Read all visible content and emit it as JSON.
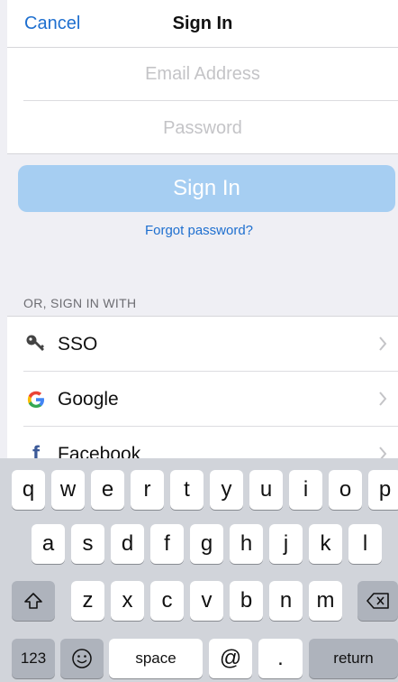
{
  "nav": {
    "cancel_label": "Cancel",
    "title": "Sign In"
  },
  "form": {
    "email_placeholder": "Email Address",
    "password_placeholder": "Password",
    "signin_label": "Sign In",
    "forgot_label": "Forgot password?"
  },
  "providers": {
    "section_label": "OR, SIGN IN WITH",
    "items": [
      {
        "label": "SSO",
        "icon": "key-icon"
      },
      {
        "label": "Google",
        "icon": "google-icon"
      },
      {
        "label": "Facebook",
        "icon": "facebook-icon"
      }
    ]
  },
  "keyboard": {
    "row1": [
      "q",
      "w",
      "e",
      "r",
      "t",
      "y",
      "u",
      "i",
      "o",
      "p"
    ],
    "row2": [
      "a",
      "s",
      "d",
      "f",
      "g",
      "h",
      "j",
      "k",
      "l"
    ],
    "row3": [
      "z",
      "x",
      "c",
      "v",
      "b",
      "n",
      "m"
    ],
    "numbers_label": "123",
    "space_label": "space",
    "at_label": "@",
    "period_label": ".",
    "return_label": "return"
  },
  "colors": {
    "accent": "#1e6fcf",
    "button_disabled": "#a6cef2",
    "keyboard_bg": "#d1d4da"
  }
}
